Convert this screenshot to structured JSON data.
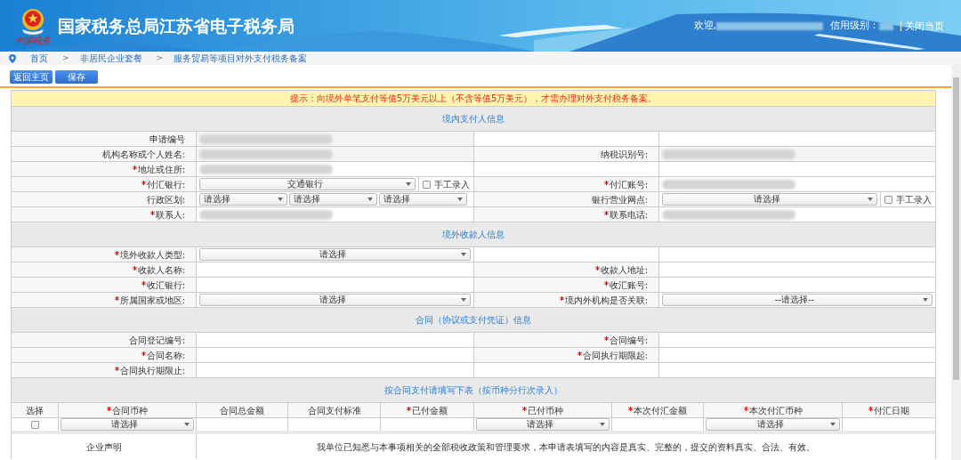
{
  "header": {
    "logo_text": "中国税务",
    "title": "国家税务总局江苏省电子税务局",
    "welcome": "欢迎,",
    "credit_label": "信用级别：",
    "close": "关闭当页"
  },
  "breadcrumb": {
    "separator": ">",
    "items": [
      "首页",
      "非居民企业套餐",
      "服务贸易等项目对外支付税务备案"
    ]
  },
  "buttons": [
    "返回主页",
    "保存"
  ],
  "notice": "提示：向境外单笔支付等值5万美元以上（不含等值5万美元），才需办理对外支付税务备案。",
  "sections": [
    {
      "title": "境内支付人信息",
      "rows": [
        {
          "left": {
            "label": "申请编号",
            "required": false,
            "kind": "text",
            "redacted": true,
            "readonly": true
          }
        },
        {
          "left": {
            "label": "机构名称或个人姓名:",
            "required": false,
            "kind": "text",
            "redacted": true,
            "readonly": true
          },
          "right": {
            "label": "纳税识别号:",
            "required": false,
            "kind": "text",
            "redacted": true,
            "readonly": true
          }
        },
        {
          "left": {
            "label": "地址或住所:",
            "required": true,
            "kind": "text",
            "redacted": true
          }
        },
        {
          "left": {
            "label": "付汇银行:",
            "required": true,
            "kind": "select",
            "value": "交通银行",
            "manual": {
              "label": "手工录入",
              "checked": false
            }
          },
          "right": {
            "label": "付汇账号:",
            "required": true,
            "kind": "text",
            "redacted": true
          }
        },
        {
          "left": {
            "label": "行政区划:",
            "required": false,
            "kind": "selects",
            "values": [
              "请选择",
              "请选择",
              "请选择"
            ]
          },
          "right": {
            "label": "银行营业网点:",
            "required": false,
            "kind": "select",
            "value": "请选择",
            "manual": {
              "label": "手工录入",
              "checked": false
            }
          }
        },
        {
          "left": {
            "label": "联系人:",
            "required": true,
            "kind": "text",
            "redacted": true
          },
          "right": {
            "label": "联系电话:",
            "required": true,
            "kind": "text",
            "redacted": true
          }
        }
      ]
    },
    {
      "title": "境外收款人信息",
      "rows": [
        {
          "left": {
            "label": "境外收款人类型:",
            "required": true,
            "kind": "select",
            "value": "请选择"
          }
        },
        {
          "left": {
            "label": "收款人名称:",
            "required": true,
            "kind": "text"
          },
          "right": {
            "label": "收款人地址:",
            "required": true,
            "kind": "text"
          }
        },
        {
          "left": {
            "label": "收汇银行:",
            "required": true,
            "kind": "text"
          },
          "right": {
            "label": "收汇账号:",
            "required": true,
            "kind": "text"
          }
        },
        {
          "left": {
            "label": "所属国家或地区:",
            "required": true,
            "kind": "select",
            "value": "请选择"
          },
          "right": {
            "label": "境内外机构是否关联:",
            "required": true,
            "kind": "select",
            "value": "--请选择--"
          }
        }
      ]
    },
    {
      "title": "合同（协议或支付凭证）信息",
      "rows": [
        {
          "left": {
            "label": "合同登记编号:",
            "required": false,
            "kind": "text"
          },
          "right": {
            "label": "合同编号:",
            "required": true,
            "kind": "text"
          }
        },
        {
          "left": {
            "label": "合同名称:",
            "required": true,
            "kind": "text"
          },
          "right": {
            "label": "合同执行期限起:",
            "required": true,
            "kind": "text"
          }
        },
        {
          "left": {
            "label": "合同执行期限止:",
            "required": true,
            "kind": "text"
          }
        }
      ]
    }
  ],
  "payment": {
    "title": "按合同支付请填写下表（按币种分行次录入）",
    "columns": [
      {
        "label": "选择",
        "required": false
      },
      {
        "label": "合同币种",
        "required": true
      },
      {
        "label": "合同总金额",
        "required": false
      },
      {
        "label": "合同支付标准",
        "required": false
      },
      {
        "label": "已付金额",
        "required": true
      },
      {
        "label": "已付币种",
        "required": true
      },
      {
        "label": "本次付汇金额",
        "required": true
      },
      {
        "label": "本次付汇币种",
        "required": true
      },
      {
        "label": "付汇日期",
        "required": true
      }
    ],
    "rows": [
      {
        "cells": [
          {
            "kind": "checkbox",
            "checked": false
          },
          {
            "kind": "select",
            "value": "请选择"
          },
          {
            "kind": "text"
          },
          {
            "kind": "text"
          },
          {
            "kind": "text"
          },
          {
            "kind": "select",
            "value": "请选择"
          },
          {
            "kind": "text"
          },
          {
            "kind": "select",
            "value": "请选择"
          },
          {
            "kind": "text"
          }
        ]
      }
    ]
  },
  "declaration": {
    "label": "企业声明",
    "text": "我单位已知悉与本事项相关的全部税收政策和管理要求，本申请表填写的内容是真实、完整的，提交的资料真实、合法、有效。"
  }
}
